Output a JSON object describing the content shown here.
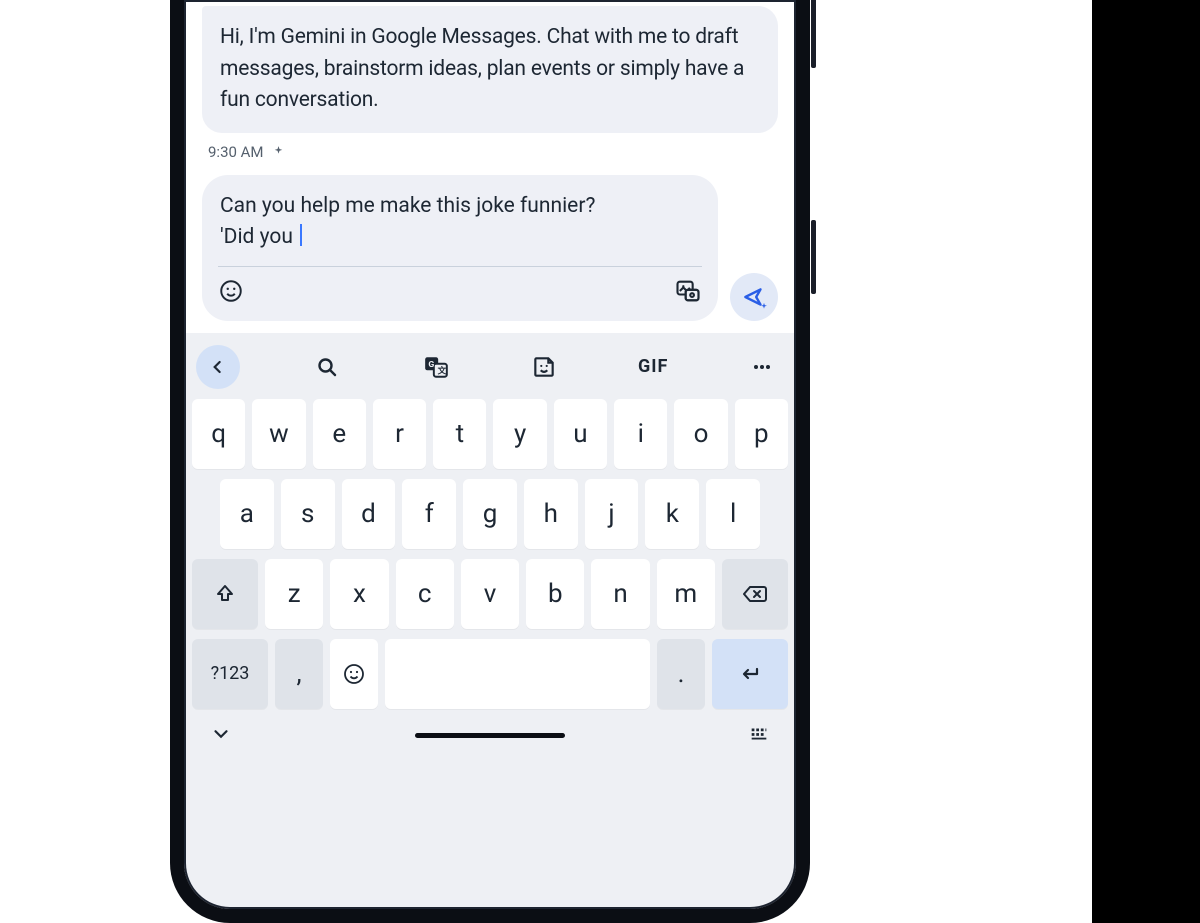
{
  "chat": {
    "intro_message": "Hi, I'm Gemini in Google Messages. Chat with me to draft messages, brainstorm ideas, plan events or simply have a fun conversation.",
    "timestamp": "9:30 AM"
  },
  "compose": {
    "text_line1": "Can you help me make this joke funnier?",
    "text_line2": "'Did you "
  },
  "keyboard": {
    "toolbar": {
      "gif_label": "GIF"
    },
    "row1": [
      "q",
      "w",
      "e",
      "r",
      "t",
      "y",
      "u",
      "i",
      "o",
      "p"
    ],
    "row2": [
      "a",
      "s",
      "d",
      "f",
      "g",
      "h",
      "j",
      "k",
      "l"
    ],
    "row3_letters": [
      "z",
      "x",
      "c",
      "v",
      "b",
      "n",
      "m"
    ],
    "sym_label": "?123",
    "comma": ",",
    "period": "."
  }
}
